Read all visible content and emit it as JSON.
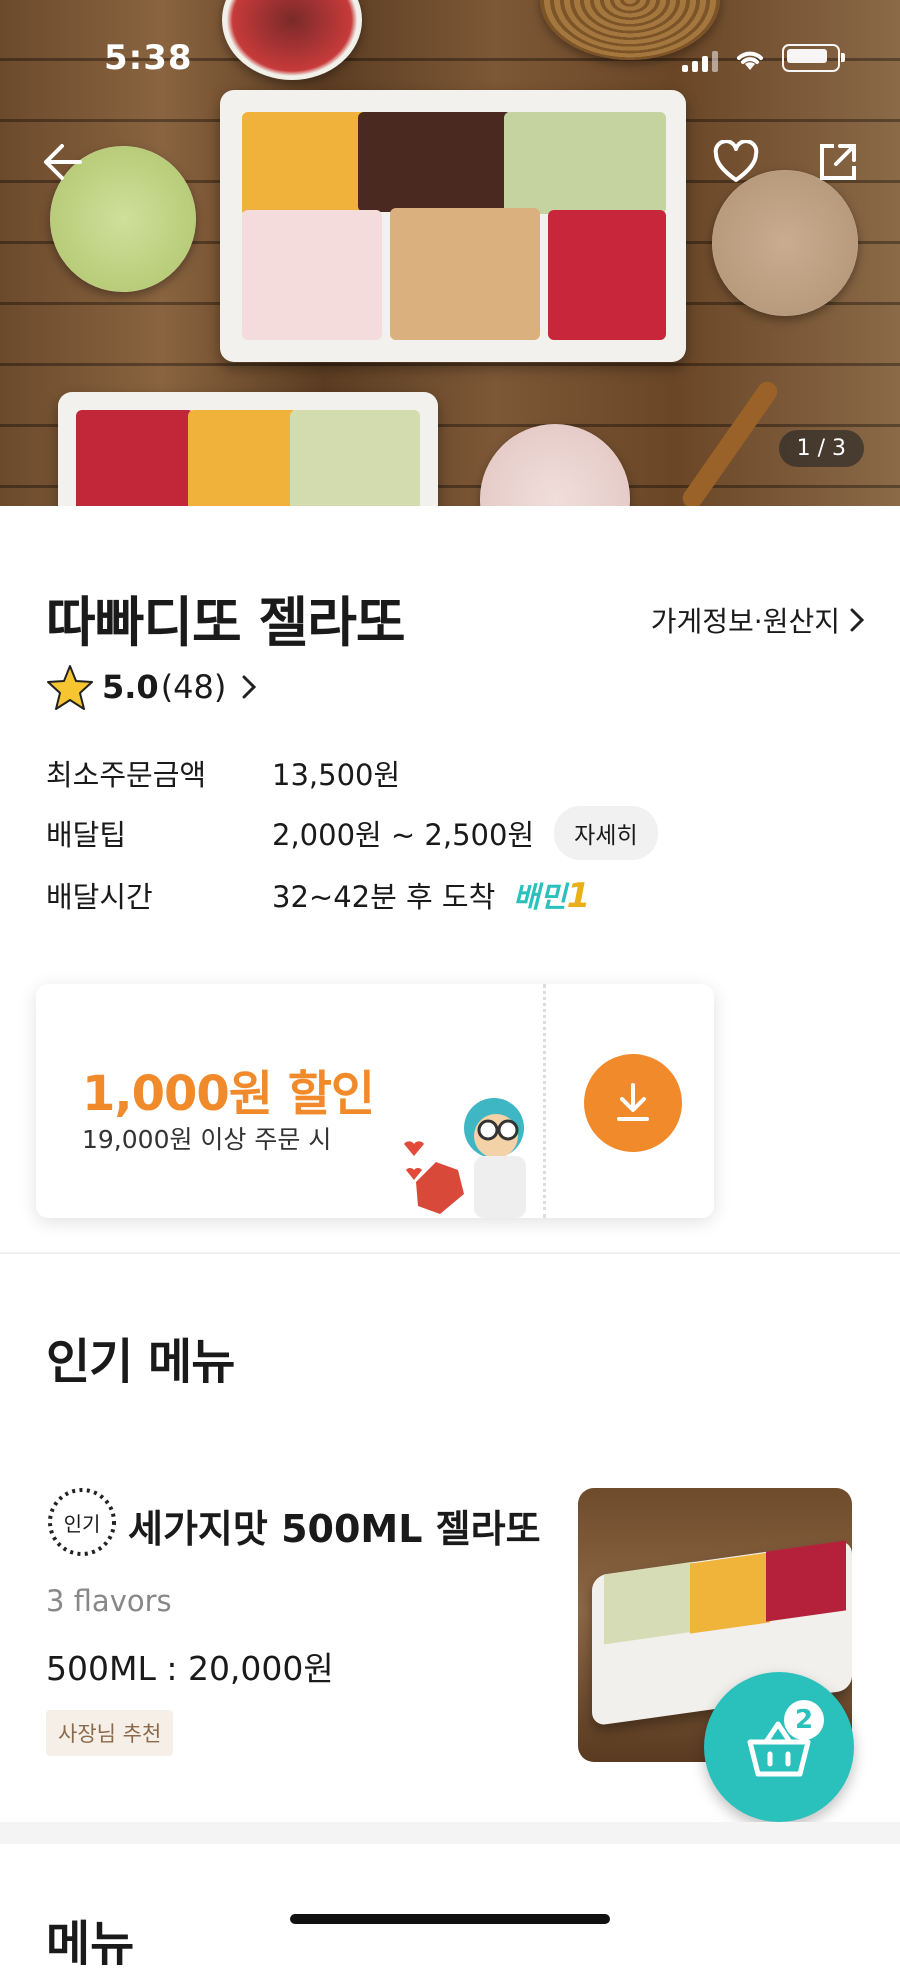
{
  "status_bar": {
    "time": "5:38"
  },
  "hero": {
    "page_indicator": "1 / 3"
  },
  "store": {
    "name": "따빠디또 젤라또",
    "info_link": "가게정보·원산지",
    "rating": "5.0",
    "review_count": "(48)"
  },
  "delivery": {
    "min_order_label": "최소주문금액",
    "min_order_value": "13,500원",
    "tip_label": "배달팁",
    "tip_value": "2,000원 ~ 2,500원",
    "detail_button": "자세히",
    "time_label": "배달시간",
    "time_value": "32~42분 후 도착",
    "baemin1": "배민",
    "baemin1_num": "1"
  },
  "coupon": {
    "amount": "1,000원 할인",
    "condition": "19,000원 이상 주문 시"
  },
  "popular": {
    "title": "인기 메뉴",
    "badge": "인기",
    "item": {
      "name": "세가지맛 500ML 젤라또",
      "desc": "3 flavors",
      "price": "500ML : 20,000원",
      "tag": "사장님 추천"
    }
  },
  "cart": {
    "count": "2"
  },
  "menu_section": {
    "title": "메뉴"
  },
  "colors": {
    "accent_orange": "#f08a2a",
    "mint": "#2ac1bc"
  }
}
